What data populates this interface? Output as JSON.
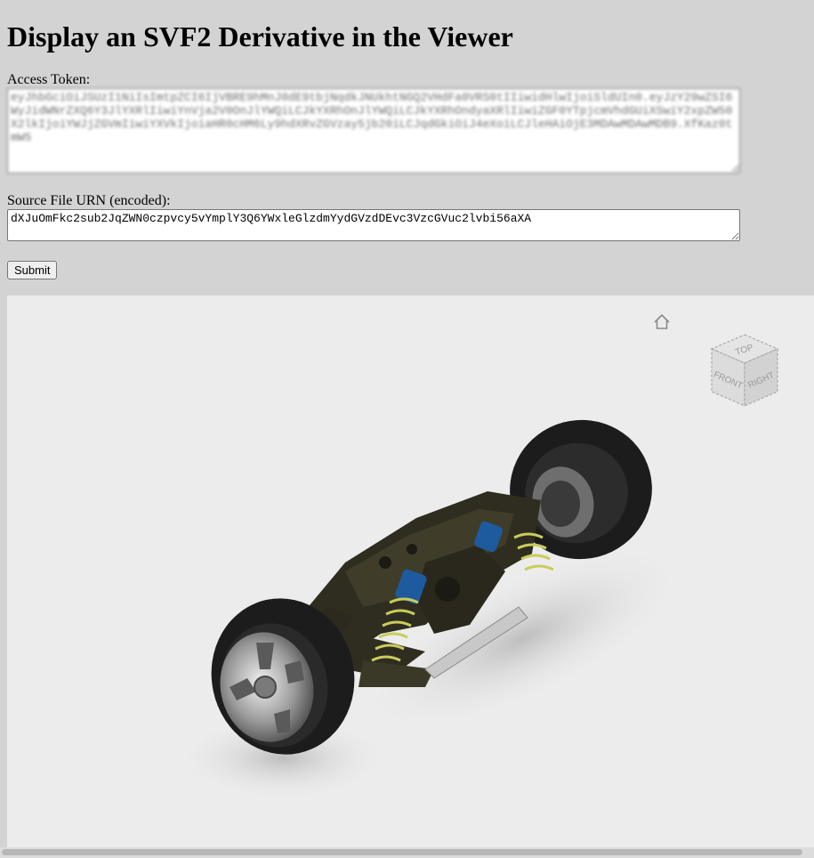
{
  "page": {
    "title": "Display an SVF2 Derivative in the Viewer"
  },
  "form": {
    "token_label": "Access Token:",
    "token_value": "eyJhbGciOiJSUzI1NiIsImtpZCI6IjVBRE9hMnJ0dE9tbjNqdkJNUkhtNGQ2VHdFa0VRS0tIIiwidHlwIjoiSldUIn0.eyJzY29wZSI6WyJidWNrZXQ6Y3JlYXRlIiwiYnVja2V0OnJlYWQiLCJkYXRhOnJlYWQiLCJkYXRhOndyaXRlIiwiZGF0YTpjcmVhdGUiXSwiY2xpZW50X2lkIjoiYWJjZGVmIiwiYXVkIjoiaHR0cHM6Ly9hdXRvZGVzay5jb20iLCJqdGkiOiJ4eXoiLCJleHAiOjE3MDAwMDAwMDB9.XfKaz0tmW5",
    "urn_label": "Source File URN (encoded):",
    "urn_value": "dXJuOmFkc2sub2JqZWN0czpvcy5vYmplY3Q6YWxleGlzdmYydGVzdDEvc3VzcGVuc2lvbi56aXA",
    "submit_label": "Submit"
  },
  "viewer": {
    "viewcube_faces": {
      "top": "TOP",
      "front": "FRONT",
      "right": "RIGHT"
    },
    "model": "car suspension assembly"
  },
  "colors": {
    "page_bg": "#d3d3d3",
    "viewer_bg": "#ececec",
    "shock_blue": "#1e5a9e",
    "spring_yellow": "#c9cc5a",
    "frame_dark": "#2c2a1e"
  }
}
